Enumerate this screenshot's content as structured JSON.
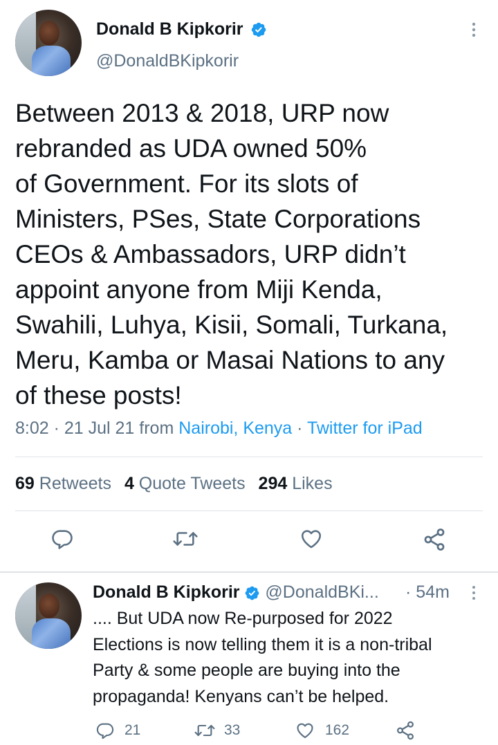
{
  "main_tweet": {
    "author_name": "Donald B Kipkorir",
    "handle": "@DonaldBKipkorir",
    "text_lines": [
      "Between 2013 & 2018, URP now",
      "rebranded as UDA owned 50%",
      "of Government. For its slots of",
      "Ministers, PSes, State Corporations",
      "CEOs & Ambassadors, URP didn’t",
      "appoint anyone from Miji Kenda,",
      "Swahili, Luhya, Kisii, Somali, Turkana,",
      "Meru, Kamba or Masai Nations to any",
      "of these posts!"
    ],
    "time_date": "8:02 · 21 Jul 21 from ",
    "location": "Nairobi, Kenya",
    "separator": " · ",
    "source": "Twitter for iPad",
    "stats": {
      "retweets_count": "69",
      "retweets_label": "Retweets",
      "quotes_count": "4",
      "quotes_label": "Quote Tweets",
      "likes_count": "294",
      "likes_label": "Likes"
    }
  },
  "reply_tweet": {
    "author_name": "Donald B Kipkorir",
    "handle": "@DonaldBKi...",
    "time": "· 54m",
    "text_lines": [
      ".... But UDA now Re-purposed for 2022",
      "Elections is now telling them it is a non-tribal",
      "Party & some people are buying into the",
      "propaganda! Kenyans can’t be helped."
    ],
    "reply_count": "21",
    "retweet_count": "33",
    "like_count": "162"
  },
  "colors": {
    "accent": "#1d9bf0",
    "secondary_text": "#5b7083",
    "divider": "#dfe3e6"
  },
  "icons": [
    "verified-badge",
    "more-options",
    "reply",
    "retweet",
    "like",
    "share"
  ]
}
